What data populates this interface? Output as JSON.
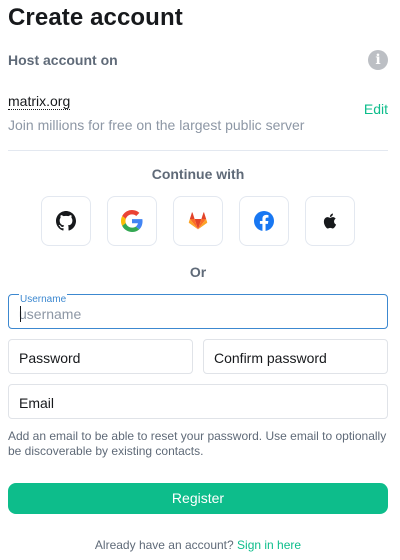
{
  "title": "Create account",
  "host": {
    "label": "Host account on",
    "info_icon": "info-icon",
    "server": "matrix.org",
    "description": "Join millions for free on the largest public server",
    "edit_label": "Edit"
  },
  "sso": {
    "label": "Continue with",
    "providers": [
      {
        "name": "GitHub",
        "icon": "github-icon"
      },
      {
        "name": "Google",
        "icon": "google-icon"
      },
      {
        "name": "GitLab",
        "icon": "gitlab-icon"
      },
      {
        "name": "Facebook",
        "icon": "facebook-icon"
      },
      {
        "name": "Apple",
        "icon": "apple-icon"
      }
    ]
  },
  "or_label": "Or",
  "form": {
    "username_label": "Username",
    "username_placeholder": "username",
    "username_value": "",
    "password_placeholder": "Password",
    "confirm_placeholder": "Confirm password",
    "email_placeholder": "Email",
    "email_help": "Add an email to be able to reset your password. Use email to optionally be discoverable by existing contacts."
  },
  "register_label": "Register",
  "signin": {
    "prompt": "Already have an account?",
    "link_label": "Sign in here"
  },
  "colors": {
    "accent": "#0dbd8b",
    "focus": "#3c88d0",
    "muted": "#5f6a78"
  }
}
